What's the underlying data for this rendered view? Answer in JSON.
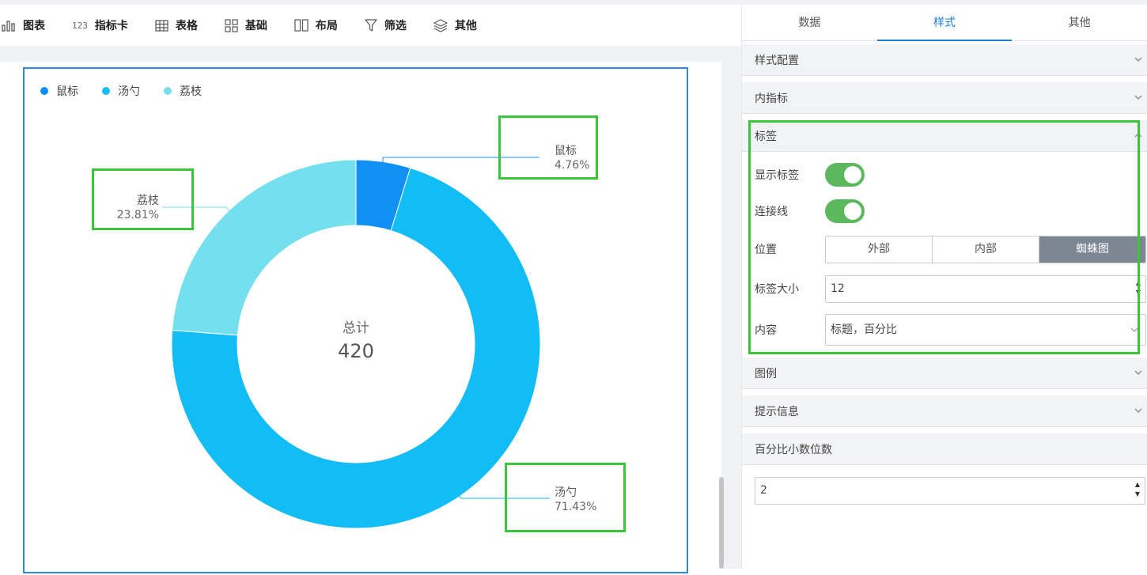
{
  "toolbar": {
    "items": [
      {
        "label": "图表",
        "icon": "bar-chart-icon"
      },
      {
        "label": "指标卡",
        "icon_text": "123",
        "icon": "number-icon"
      },
      {
        "label": "表格",
        "icon": "table-icon"
      },
      {
        "label": "基础",
        "icon": "grid-icon"
      },
      {
        "label": "布局",
        "icon": "layout-icon"
      },
      {
        "label": "筛选",
        "icon": "filter-icon"
      },
      {
        "label": "其他",
        "icon": "layers-icon"
      }
    ]
  },
  "chart": {
    "legend": [
      {
        "name": "鼠标",
        "color": "#1190f4"
      },
      {
        "name": "汤勺",
        "color": "#11bdf4"
      },
      {
        "name": "荔枝",
        "color": "#74e0ee"
      }
    ],
    "center_label": "总计",
    "center_value": "420",
    "labels": [
      {
        "name": "鼠标",
        "percent": "4.76%"
      },
      {
        "name": "荔枝",
        "percent": "23.81%"
      },
      {
        "name": "汤勺",
        "percent": "71.43%"
      }
    ]
  },
  "chart_data": {
    "type": "pie",
    "categories": [
      "鼠标",
      "汤勺",
      "荔枝"
    ],
    "values": [
      20,
      300,
      100
    ],
    "percents": [
      4.76,
      71.43,
      23.81
    ],
    "total": 420,
    "donut": true,
    "legend_position": "top-left",
    "colors": [
      "#1190f4",
      "#11bdf4",
      "#74e0ee"
    ]
  },
  "panel": {
    "tabs": [
      "数据",
      "样式",
      "其他"
    ],
    "active_tab": "样式",
    "sections": {
      "style_config": "样式配置",
      "inner_indicator": "内指标",
      "label": "标签",
      "legend": "图例",
      "tooltip": "提示信息",
      "decimal": "百分比小数位数"
    },
    "label_form": {
      "show_label": "显示标签",
      "show_label_on": true,
      "connector": "连接线",
      "connector_on": true,
      "position": "位置",
      "position_options": [
        "外部",
        "内部",
        "蜘蛛图"
      ],
      "position_selected": "蜘蛛图",
      "size_label": "标签大小",
      "size_value": "12",
      "content_label": "内容",
      "content_value": "标题，百分比"
    },
    "decimal_value": "2",
    "colors": {
      "accent": "#1f7fd6",
      "toggle_on": "#5cb85c",
      "highlight": "#39c739"
    }
  }
}
